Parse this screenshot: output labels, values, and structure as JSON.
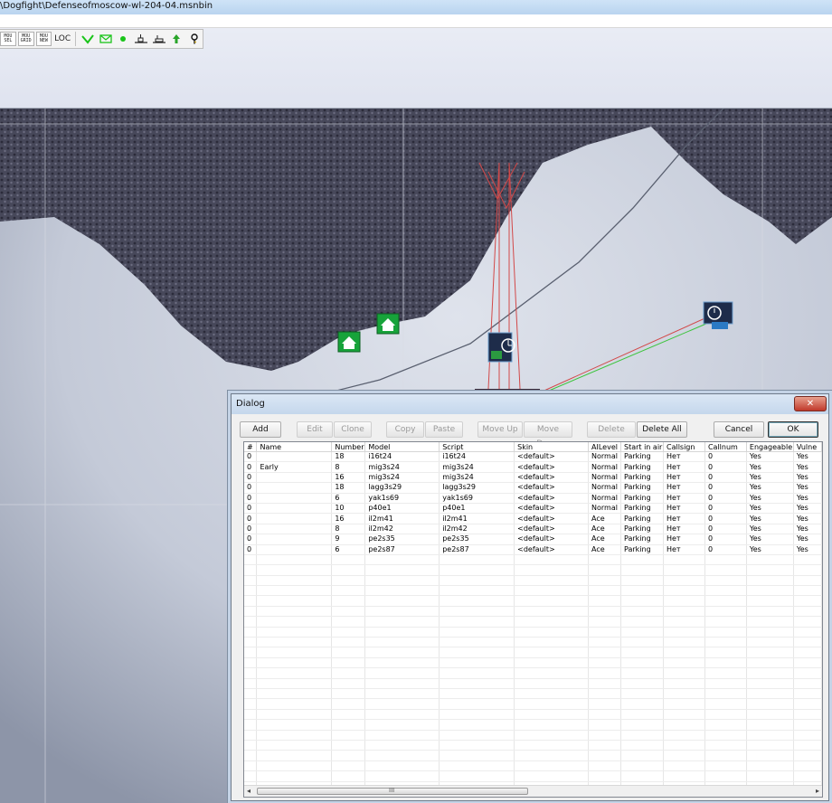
{
  "window": {
    "title": "\\Dogfight\\Defenseofmoscow-wl-204-04.msnbin"
  },
  "toolbar": {
    "buttons": [
      {
        "label": "MOU SEL",
        "icon": "mouse-select-icon"
      },
      {
        "label": "MOU GRID",
        "icon": "mouse-grid-icon"
      },
      {
        "label": "MOU NEW",
        "icon": "mouse-new-icon"
      },
      {
        "label": "LOC",
        "icon": "loc-icon"
      }
    ],
    "icons": [
      "checkmark-icon",
      "envelope-icon",
      "green-dot-icon",
      "ground-object-icon",
      "ground-object-2-icon",
      "up-arrow-icon",
      "key-icon"
    ],
    "accent": "#19c419"
  },
  "dialog": {
    "title": "Dialog",
    "close_label": "✕",
    "buttons": {
      "add": "Add",
      "edit": "Edit",
      "clone": "Clone",
      "copy": "Copy",
      "paste": "Paste",
      "move_up": "Move Up",
      "move_down": "Move Down",
      "delete": "Delete",
      "delete_all": "Delete All",
      "cancel": "Cancel",
      "ok": "OK"
    },
    "columns": [
      "#",
      "Name",
      "Number",
      "Model",
      "Script",
      "Skin",
      "AILevel",
      "Start in air",
      "Callsign",
      "Callnum",
      "Engageable",
      "Vulne"
    ],
    "rows": [
      [
        "0",
        "",
        "18",
        "i16t24",
        "i16t24",
        "<default>",
        "Normal",
        "Parking",
        "Нет",
        "0",
        "Yes",
        "Yes"
      ],
      [
        "0",
        "Early",
        "8",
        "mig3s24",
        "mig3s24",
        "<default>",
        "Normal",
        "Parking",
        "Нет",
        "0",
        "Yes",
        "Yes"
      ],
      [
        "0",
        "",
        "16",
        "mig3s24",
        "mig3s24",
        "<default>",
        "Normal",
        "Parking",
        "Нет",
        "0",
        "Yes",
        "Yes"
      ],
      [
        "0",
        "",
        "18",
        "lagg3s29",
        "lagg3s29",
        "<default>",
        "Normal",
        "Parking",
        "Нет",
        "0",
        "Yes",
        "Yes"
      ],
      [
        "0",
        "",
        "6",
        "yak1s69",
        "yak1s69",
        "<default>",
        "Normal",
        "Parking",
        "Нет",
        "0",
        "Yes",
        "Yes"
      ],
      [
        "0",
        "",
        "10",
        "p40e1",
        "p40e1",
        "<default>",
        "Normal",
        "Parking",
        "Нет",
        "0",
        "Yes",
        "Yes"
      ],
      [
        "0",
        "",
        "16",
        "il2m41",
        "il2m41",
        "<default>",
        "Ace",
        "Parking",
        "Нет",
        "0",
        "Yes",
        "Yes"
      ],
      [
        "0",
        "",
        "8",
        "il2m42",
        "il2m42",
        "<default>",
        "Ace",
        "Parking",
        "Нет",
        "0",
        "Yes",
        "Yes"
      ],
      [
        "0",
        "",
        "9",
        "pe2s35",
        "pe2s35",
        "<default>",
        "Ace",
        "Parking",
        "Нет",
        "0",
        "Yes",
        "Yes"
      ],
      [
        "0",
        "",
        "6",
        "pe2s87",
        "pe2s87",
        "<default>",
        "Ace",
        "Parking",
        "Нет",
        "0",
        "Yes",
        "Yes"
      ]
    ],
    "scroll": {
      "left": "◂",
      "right": "▸",
      "thumb_grip": "III"
    }
  }
}
